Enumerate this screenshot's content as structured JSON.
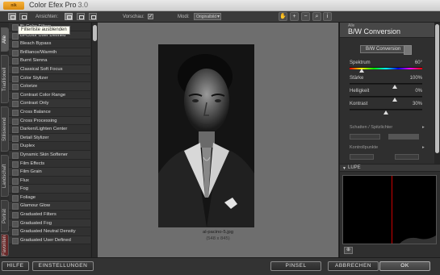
{
  "app": {
    "title": "Color Efex Pro",
    "version": "3.0",
    "logo_text": "nik"
  },
  "toolbar": {
    "ansichten_label": "Ansichten:",
    "vorschau_label": "Vorschau:",
    "vorschau_checked": "✓",
    "modi_label": "Modi:",
    "modi_value": "Originalbild"
  },
  "tooltip": "Filterliste ausblenden",
  "vertical_tabs": [
    "Alle",
    "Traditionell",
    "Stilisierend",
    "Landschaft",
    "Porträt",
    "Favoriten"
  ],
  "filters": [
    "Bi-Color Filters",
    "Bi-Color User Defined",
    "Bleach Bypass",
    "Brilliance/Warmth",
    "Burnt Sienna",
    "Classical Soft Focus",
    "Color Stylizer",
    "Colorize",
    "Contrast Color Range",
    "Contrast Only",
    "Cross Balance",
    "Cross Processing",
    "Darken/Lighten Center",
    "Detail Stylizer",
    "Duplex",
    "Dynamic Skin Softener",
    "Film Effects",
    "Film Grain",
    "Flux",
    "Fog",
    "Foliage",
    "Glamour Glow",
    "Graduated Filters",
    "Graduated Fog",
    "Graduated Neutral Density",
    "Graduated User Defined"
  ],
  "preview": {
    "filename": "al-pacino-5.jpg",
    "dimensions": "(548 x 845)"
  },
  "right_panel": {
    "category": "Alle",
    "filter_name": "B/W Conversion",
    "method_value": "B/W Conversion",
    "sliders": [
      {
        "label": "Spektrum",
        "value": "60°",
        "fraction": 0.17
      },
      {
        "label": "Stärke",
        "value": "100%",
        "fraction": 0.62
      },
      {
        "label": "Helligkeit",
        "value": "0%",
        "fraction": 0.62
      },
      {
        "label": "Kontrast",
        "value": "30%",
        "fraction": 0.5
      }
    ],
    "section_shadows": "Schatten / Spitzlichter",
    "section_control_points": "Kontrollpunkte",
    "loupe_label": "LUPE"
  },
  "bottom": {
    "help": "HILFE",
    "settings": "EINSTELLUNGEN",
    "brush": "PINSEL",
    "cancel": "ABBRECHEN",
    "ok": "OK"
  }
}
